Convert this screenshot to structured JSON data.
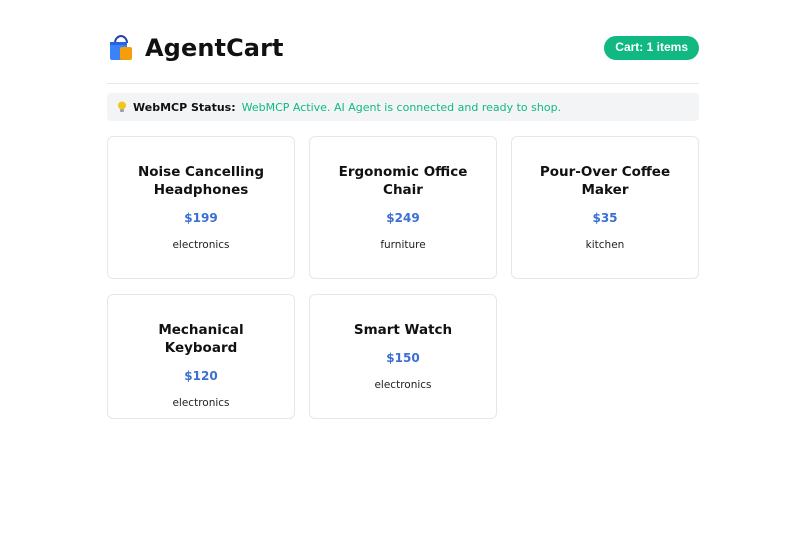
{
  "header": {
    "title": "AgentCart",
    "cart_label": "Cart: 1 items"
  },
  "status": {
    "label": "WebMCP Status:",
    "message": "WebMCP Active. AI Agent is connected and ready to shop."
  },
  "products": [
    {
      "name": "Noise Cancelling Headphones",
      "price": "$199",
      "category": "electronics"
    },
    {
      "name": "Ergonomic Office Chair",
      "price": "$249",
      "category": "furniture"
    },
    {
      "name": "Pour-Over Coffee Maker",
      "price": "$35",
      "category": "kitchen"
    },
    {
      "name": "Mechanical Keyboard",
      "price": "$120",
      "category": "electronics"
    },
    {
      "name": "Smart Watch",
      "price": "$150",
      "category": "electronics"
    }
  ],
  "icons": {
    "logo": "shopping-bag-icon",
    "status": "light-bulb-icon"
  },
  "colors": {
    "accent_green": "#10b981",
    "price_blue": "#3b6fd4",
    "status_bg": "#f3f4f6"
  }
}
